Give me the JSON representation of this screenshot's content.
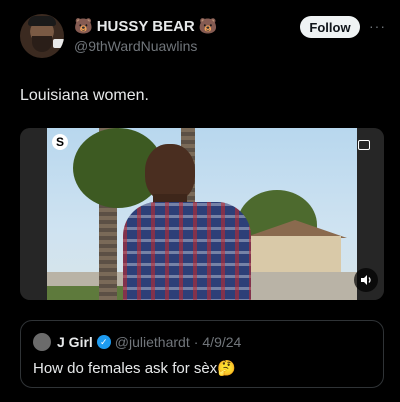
{
  "author": {
    "emoji_left": "🐻",
    "display_name": "HUSSY BEAR",
    "emoji_right": "🐻",
    "handle": "@9thWardNuawlins"
  },
  "actions": {
    "follow_label": "Follow",
    "more_label": "···"
  },
  "tweet": {
    "text": "Louisiana women."
  },
  "media": {
    "watermark_letter": "S",
    "type": "video"
  },
  "quote": {
    "display_name": "J Girl",
    "handle": "@juliethardt",
    "separator": "·",
    "date": "4/9/24",
    "text": "How do females ask for sèx🤔"
  }
}
